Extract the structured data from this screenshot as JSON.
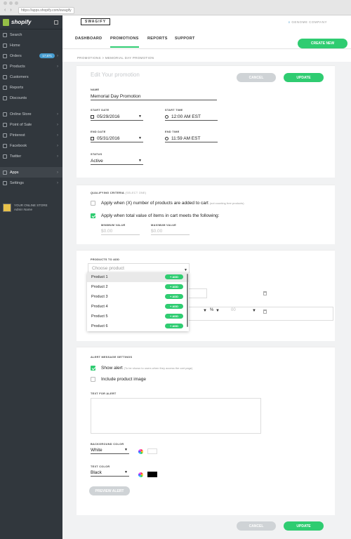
{
  "browser": {
    "url": "https://apps.shopify.com/swagify"
  },
  "sidebar": {
    "brand": "shopify",
    "items": [
      {
        "label": "Search",
        "icon": "search-icon"
      },
      {
        "label": "Home",
        "icon": "home-icon"
      },
      {
        "label": "Orders",
        "icon": "orders-icon",
        "badge": "17,871"
      },
      {
        "label": "Products",
        "icon": "tag-icon"
      },
      {
        "label": "Customers",
        "icon": "customers-icon"
      },
      {
        "label": "Reports",
        "icon": "reports-icon"
      },
      {
        "label": "Discounts",
        "icon": "discounts-icon"
      },
      {
        "label": "Online Store",
        "icon": "globe-icon"
      },
      {
        "label": "Point of Sale",
        "icon": "pos-icon"
      },
      {
        "label": "Pinterest",
        "icon": "pinterest-icon"
      },
      {
        "label": "Facebook",
        "icon": "facebook-icon"
      },
      {
        "label": "Twitter",
        "icon": "twitter-icon"
      },
      {
        "label": "Apps",
        "icon": "apps-icon"
      },
      {
        "label": "Settings",
        "icon": "gear-icon"
      }
    ],
    "store_name": "YOUR ONLINE STORE",
    "store_user": "Admin Name"
  },
  "app": {
    "logo": "SWAGIFY",
    "company": "GENOME COMPANY",
    "tabs": [
      "DASHBOARD",
      "PROMOTIONS",
      "REPORTS",
      "SUPPORT"
    ],
    "active_tab": "PROMOTIONS",
    "create_new": "CREATE NEW",
    "breadcrumb": {
      "parent": "PROMOTIONS",
      "sep": ">",
      "current": "MEMORIAL DAY PROMOTION"
    }
  },
  "form": {
    "heading": "Edit Your promotion",
    "cancel": "CANCEL",
    "update": "UPDATE",
    "name_label": "NAME",
    "name_value": "Memorial Day Promotion",
    "start_date_label": "START DATE",
    "start_date": "05/29/2016",
    "start_time_label": "START TIME",
    "start_time": "12:00 AM EST",
    "end_date_label": "END DATE",
    "end_date": "05/31/2016",
    "end_time_label": "END TIME",
    "end_time": "11:59 AM EST",
    "status_label": "STATUS",
    "status": "Active"
  },
  "criteria": {
    "label": "QUALIFYING CRITERIA",
    "label_hint": "(SELECT ONE)",
    "opt1": "Apply when (X) number of products are added to cart",
    "opt1_hint": "(not counting free products)",
    "opt2": "Apply when total value of items in cart meets the following:",
    "min_label": "MINIMUM VALUE",
    "min_placeholder": "$0.00",
    "max_label": "MAXIMUM VALUE",
    "max_placeholder": "$0.00"
  },
  "products": {
    "label": "PRODUCTS TO ADD",
    "placeholder": "Choose product",
    "add_label": "+ ADD",
    "items": [
      "Product 1",
      "Product 2",
      "Product 3",
      "Product 4",
      "Product 5",
      "Product 6"
    ],
    "pct": "%",
    "zero": "00"
  },
  "alert": {
    "label": "ALERT MESSAGE SETTINGS",
    "show": "Show alert",
    "show_hint": "(To be shown to users when they access the cart page)",
    "include_image": "Include product image",
    "text_label": "TEXT FOR ALERT",
    "bg_label": "BACKGROUND COLOR",
    "bg_value": "White",
    "bg_color": "#ffffff",
    "text_color_label": "TEXT COLOR",
    "text_color_value": "Black",
    "text_color": "#000000",
    "preview": "PREVIEW ALERT"
  },
  "footer": {
    "cancel": "CANCEL",
    "update": "UPDATE"
  },
  "colors": {
    "accent": "#2fcc71",
    "sidebar": "#31373d",
    "badge": "#479ccf"
  }
}
